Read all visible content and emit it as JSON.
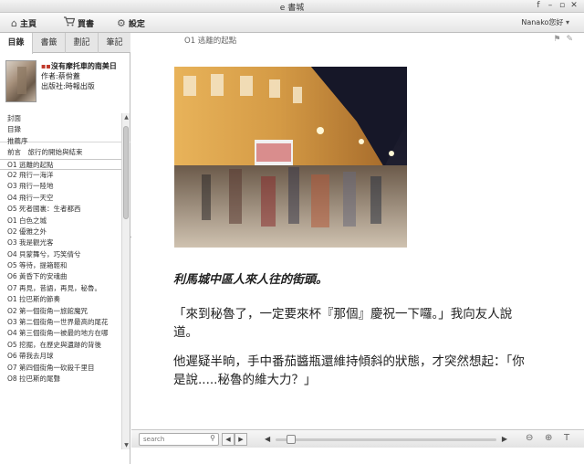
{
  "app": {
    "title": "e 書城"
  },
  "window_controls": [
    "f",
    "–",
    "▫",
    "✕"
  ],
  "toolbar": {
    "home_label": "主頁",
    "buy_label": "買書",
    "settings_label": "設定",
    "user_label": "Nanako您好"
  },
  "sidebar": {
    "tabs": [
      "目錄",
      "書籤",
      "劃記",
      "筆記"
    ],
    "active_tab": "目錄",
    "book": {
      "title": "沒有摩托車的南美日",
      "author": "作者:蔡佾蓋",
      "publisher": "出版社:時報出版"
    },
    "toc": [
      "封面",
      "目錄",
      "推薦序",
      "前言　旅行的開始與結束",
      "O1 逃離的起點",
      "O2 飛行一海洋",
      "O3 飛行一陸地",
      "O4 飛行一天空",
      "O5 死者國裏：生者都西",
      "O1 白色之城",
      "O2 優雅之外",
      "O3 我是觀光客",
      "O4 貝蒙舞兮，巧笑倩兮",
      "O5 等待，提箱輕和",
      "O6 黃昏下的安魂曲",
      "O7 再見，昔語，再見，秘魯。",
      "O1 拉巴斯的節奏",
      "O2 第一個街角一旅館魔咒",
      "O3 第二個街角一世界最高的尾花",
      "O4 第三個街角一被最的地方在哪",
      "O5 挖掘，在歷史與遺跡的背後",
      "O6 帶我去月球",
      "O7 第四個街角一砍殺千里目",
      "O8 拉巴斯的尾聲"
    ],
    "active_toc_index": 4
  },
  "reader": {
    "chapter_heading": "O1 逃離的起點",
    "caption": "利馬城中區人來人往的街頭。",
    "paragraphs": [
      "「來到秘魯了，一定要來杯『那個』慶祝一下囉。」我向友人說道。",
      "他遲疑半晌，手中番茄醬瓶還維持傾斜的狀態，才突然想起：「你是說.....秘魯的維大力？」"
    ]
  },
  "bottom": {
    "search_placeholder": "search",
    "reading_progress": 0.05
  }
}
